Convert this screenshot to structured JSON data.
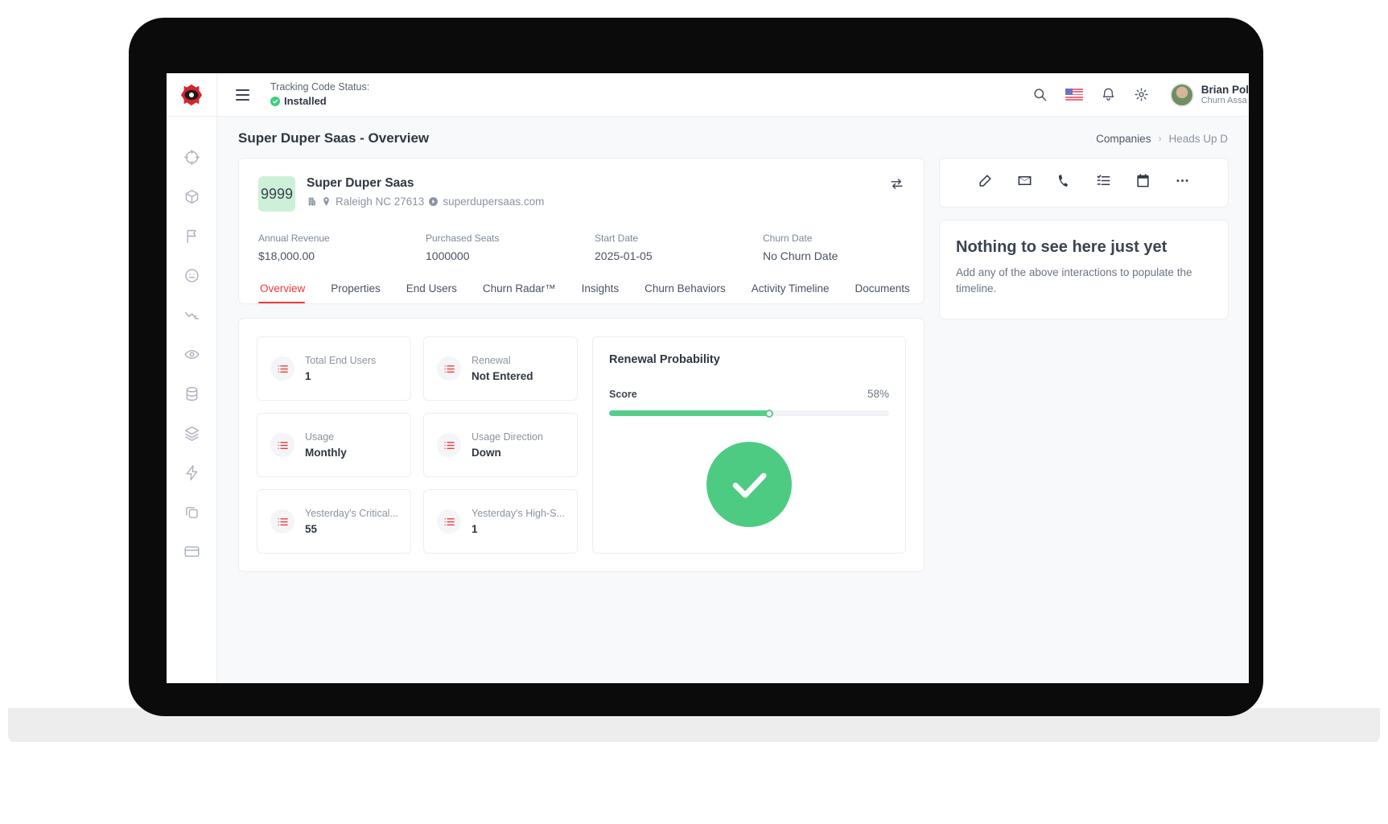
{
  "header": {
    "tracking_label": "Tracking Code Status:",
    "tracking_status": "Installed",
    "icons": [
      "search-icon",
      "us-flag-icon",
      "bell-icon",
      "gear-icon"
    ],
    "user_name": "Brian Pol",
    "user_role": "Churn Assa"
  },
  "sidebar": {
    "items": [
      {
        "icon": "target-icon"
      },
      {
        "icon": "cube-icon"
      },
      {
        "icon": "flag-icon"
      },
      {
        "icon": "face-icon"
      },
      {
        "icon": "trending-down-icon"
      },
      {
        "icon": "eye-icon"
      },
      {
        "icon": "database-icon"
      },
      {
        "icon": "layers-icon"
      },
      {
        "icon": "lightning-icon"
      },
      {
        "icon": "copy-icon"
      },
      {
        "icon": "card-icon"
      }
    ]
  },
  "page": {
    "title": "Super Duper Saas - Overview",
    "breadcrumb_root": "Companies",
    "breadcrumb_sep": "›",
    "breadcrumb_current": "Heads Up D"
  },
  "company": {
    "score_chip": "9999",
    "name": "Super Duper Saas",
    "location": "Raleigh NC 27613",
    "website": "superdupersaas.com",
    "swap_icon": "swap-icon",
    "metrics": [
      {
        "label": "Annual Revenue",
        "value": "$18,000.00"
      },
      {
        "label": "Purchased Seats",
        "value": "1000000"
      },
      {
        "label": "Start Date",
        "value": "2025-01-05"
      },
      {
        "label": "Churn Date",
        "value": "No Churn Date"
      }
    ]
  },
  "tabs": [
    {
      "label": "Overview",
      "active": true
    },
    {
      "label": "Properties",
      "active": false
    },
    {
      "label": "End Users",
      "active": false
    },
    {
      "label": "Churn Radar™",
      "active": false
    },
    {
      "label": "Insights",
      "active": false
    },
    {
      "label": "Churn Behaviors",
      "active": false
    },
    {
      "label": "Activity Timeline",
      "active": false
    },
    {
      "label": "Documents",
      "active": false
    }
  ],
  "stats": [
    {
      "label": "Total End Users",
      "value": "1"
    },
    {
      "label": "Renewal",
      "value": "Not Entered"
    },
    {
      "label": "Usage",
      "value": "Monthly"
    },
    {
      "label": "Usage Direction",
      "value": "Down"
    },
    {
      "label": "Yesterday's Critical...",
      "value": "55"
    },
    {
      "label": "Yesterday's High-S...",
      "value": "1"
    }
  ],
  "renewal": {
    "title": "Renewal Probability",
    "score_label": "Score",
    "score_pct": "58%",
    "score_value": 58,
    "status_icon": "check-circle-icon"
  },
  "side": {
    "actions": [
      {
        "icon": "edit-icon"
      },
      {
        "icon": "envelope-icon"
      },
      {
        "icon": "phone-icon"
      },
      {
        "icon": "task-list-icon"
      },
      {
        "icon": "calendar-icon"
      },
      {
        "icon": "ellipsis-icon"
      }
    ],
    "empty_title": "Nothing to see here just yet",
    "empty_text": "Add any of the above interactions to populate the timeline."
  },
  "colors": {
    "accent_red": "#ef3b3b",
    "success_green": "#4ecb83",
    "chip_green": "#cdf0d8",
    "text_dark": "#2f3742",
    "text_muted": "#8b93a1",
    "bg_page": "#f8f9fb"
  }
}
